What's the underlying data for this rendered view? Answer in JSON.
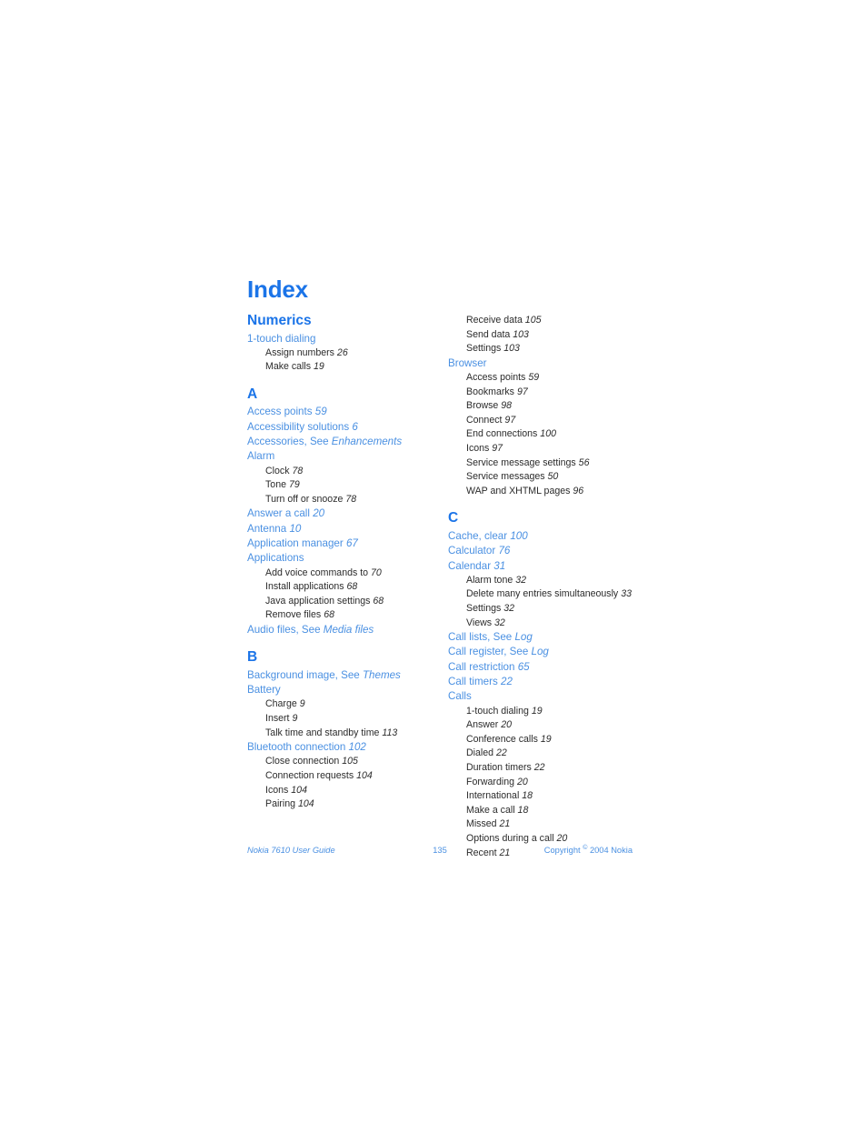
{
  "page": {
    "title": "Index",
    "number": "135"
  },
  "footer": {
    "left": "Nokia 7610 User Guide",
    "page_number": "135",
    "copyright_before": "Copyright",
    "copyright_symbol": "©",
    "copyright_after": "2004 Nokia"
  },
  "colors": {
    "heading_blue": "#1b74e8",
    "entry_blue": "#4a90e2",
    "subentry_gray": "#2b2b2b",
    "page_background": "#ffffff"
  },
  "left_column": {
    "blocks": [
      {
        "type": "section",
        "heading": "Numerics",
        "entries": [
          {
            "text": "1-touch dialing",
            "page": "",
            "subs": [
              {
                "text": "Assign numbers",
                "page": "26"
              },
              {
                "text": "Make calls",
                "page": "19"
              }
            ]
          }
        ]
      },
      {
        "type": "letter",
        "heading": "A",
        "entries": [
          {
            "text": "Access points",
            "page": "59",
            "subs": []
          },
          {
            "text": "Accessibility solutions",
            "page": "6",
            "subs": []
          },
          {
            "text": "Accessories, See ",
            "ref": "Enhancements",
            "page": "",
            "subs": []
          },
          {
            "text": "Alarm",
            "page": "",
            "subs": [
              {
                "text": "Clock",
                "page": "78"
              },
              {
                "text": "Tone",
                "page": "79"
              },
              {
                "text": "Turn off or snooze",
                "page": "78"
              }
            ]
          },
          {
            "text": "Answer a call",
            "page": "20",
            "subs": []
          },
          {
            "text": "Antenna",
            "page": "10",
            "subs": []
          },
          {
            "text": "Application manager",
            "page": "67",
            "subs": []
          },
          {
            "text": "Applications",
            "page": "",
            "subs": [
              {
                "text": "Add voice commands to",
                "page": "70"
              },
              {
                "text": "Install applications",
                "page": "68"
              },
              {
                "text": "Java application settings",
                "page": "68"
              },
              {
                "text": "Remove files",
                "page": "68"
              }
            ]
          },
          {
            "text": "Audio files, See ",
            "ref": "Media files",
            "page": "",
            "subs": []
          }
        ]
      },
      {
        "type": "letter",
        "heading": "B",
        "entries": [
          {
            "text": "Background image, See ",
            "ref": "Themes",
            "page": "",
            "subs": []
          },
          {
            "text": "Battery",
            "page": "",
            "subs": [
              {
                "text": "Charge",
                "page": "9"
              },
              {
                "text": "Insert",
                "page": "9"
              },
              {
                "text": "Talk time and standby time",
                "page": "113"
              }
            ]
          },
          {
            "text": "Bluetooth connection",
            "page": "102",
            "subs": [
              {
                "text": "Close connection",
                "page": "105"
              },
              {
                "text": "Connection requests",
                "page": "104"
              },
              {
                "text": "Icons",
                "page": "104"
              },
              {
                "text": "Pairing",
                "page": "104"
              }
            ]
          }
        ]
      }
    ]
  },
  "right_column": {
    "continued_subs": [
      {
        "text": "Receive data",
        "page": "105"
      },
      {
        "text": "Send data",
        "page": "103"
      },
      {
        "text": "Settings",
        "page": "103"
      }
    ],
    "blocks": [
      {
        "type": "plain",
        "heading": "",
        "entries": [
          {
            "text": "Browser",
            "page": "",
            "subs": [
              {
                "text": "Access points",
                "page": "59"
              },
              {
                "text": "Bookmarks",
                "page": "97"
              },
              {
                "text": "Browse",
                "page": "98"
              },
              {
                "text": "Connect",
                "page": "97"
              },
              {
                "text": "End connections",
                "page": "100"
              },
              {
                "text": "Icons",
                "page": "97"
              },
              {
                "text": "Service message settings",
                "page": "56"
              },
              {
                "text": "Service messages",
                "page": "50"
              },
              {
                "text": "WAP and XHTML pages",
                "page": "96"
              }
            ]
          }
        ]
      },
      {
        "type": "letter",
        "heading": "C",
        "entries": [
          {
            "text": "Cache, clear",
            "page": "100",
            "subs": []
          },
          {
            "text": "Calculator",
            "page": "76",
            "subs": []
          },
          {
            "text": "Calendar",
            "page": "31",
            "subs": [
              {
                "text": "Alarm tone",
                "page": "32"
              },
              {
                "text": "Delete many entries simultaneously",
                "page": "33"
              },
              {
                "text": "Settings",
                "page": "32"
              },
              {
                "text": "Views",
                "page": "32"
              }
            ]
          },
          {
            "text": "Call lists, See ",
            "ref": "Log",
            "page": "",
            "subs": []
          },
          {
            "text": "Call register, See ",
            "ref": "Log",
            "page": "",
            "subs": []
          },
          {
            "text": "Call restriction",
            "page": "65",
            "subs": []
          },
          {
            "text": "Call timers",
            "page": "22",
            "subs": []
          },
          {
            "text": "Calls",
            "page": "",
            "subs": [
              {
                "text": "1-touch dialing",
                "page": "19"
              },
              {
                "text": "Answer",
                "page": "20"
              },
              {
                "text": "Conference calls",
                "page": "19"
              },
              {
                "text": "Dialed",
                "page": "22"
              },
              {
                "text": "Duration timers",
                "page": "22"
              },
              {
                "text": "Forwarding",
                "page": "20"
              },
              {
                "text": "International",
                "page": "18"
              },
              {
                "text": "Make a call",
                "page": "18"
              },
              {
                "text": "Missed",
                "page": "21"
              },
              {
                "text": "Options during a call",
                "page": "20"
              },
              {
                "text": "Recent",
                "page": "21"
              }
            ]
          }
        ]
      }
    ]
  }
}
